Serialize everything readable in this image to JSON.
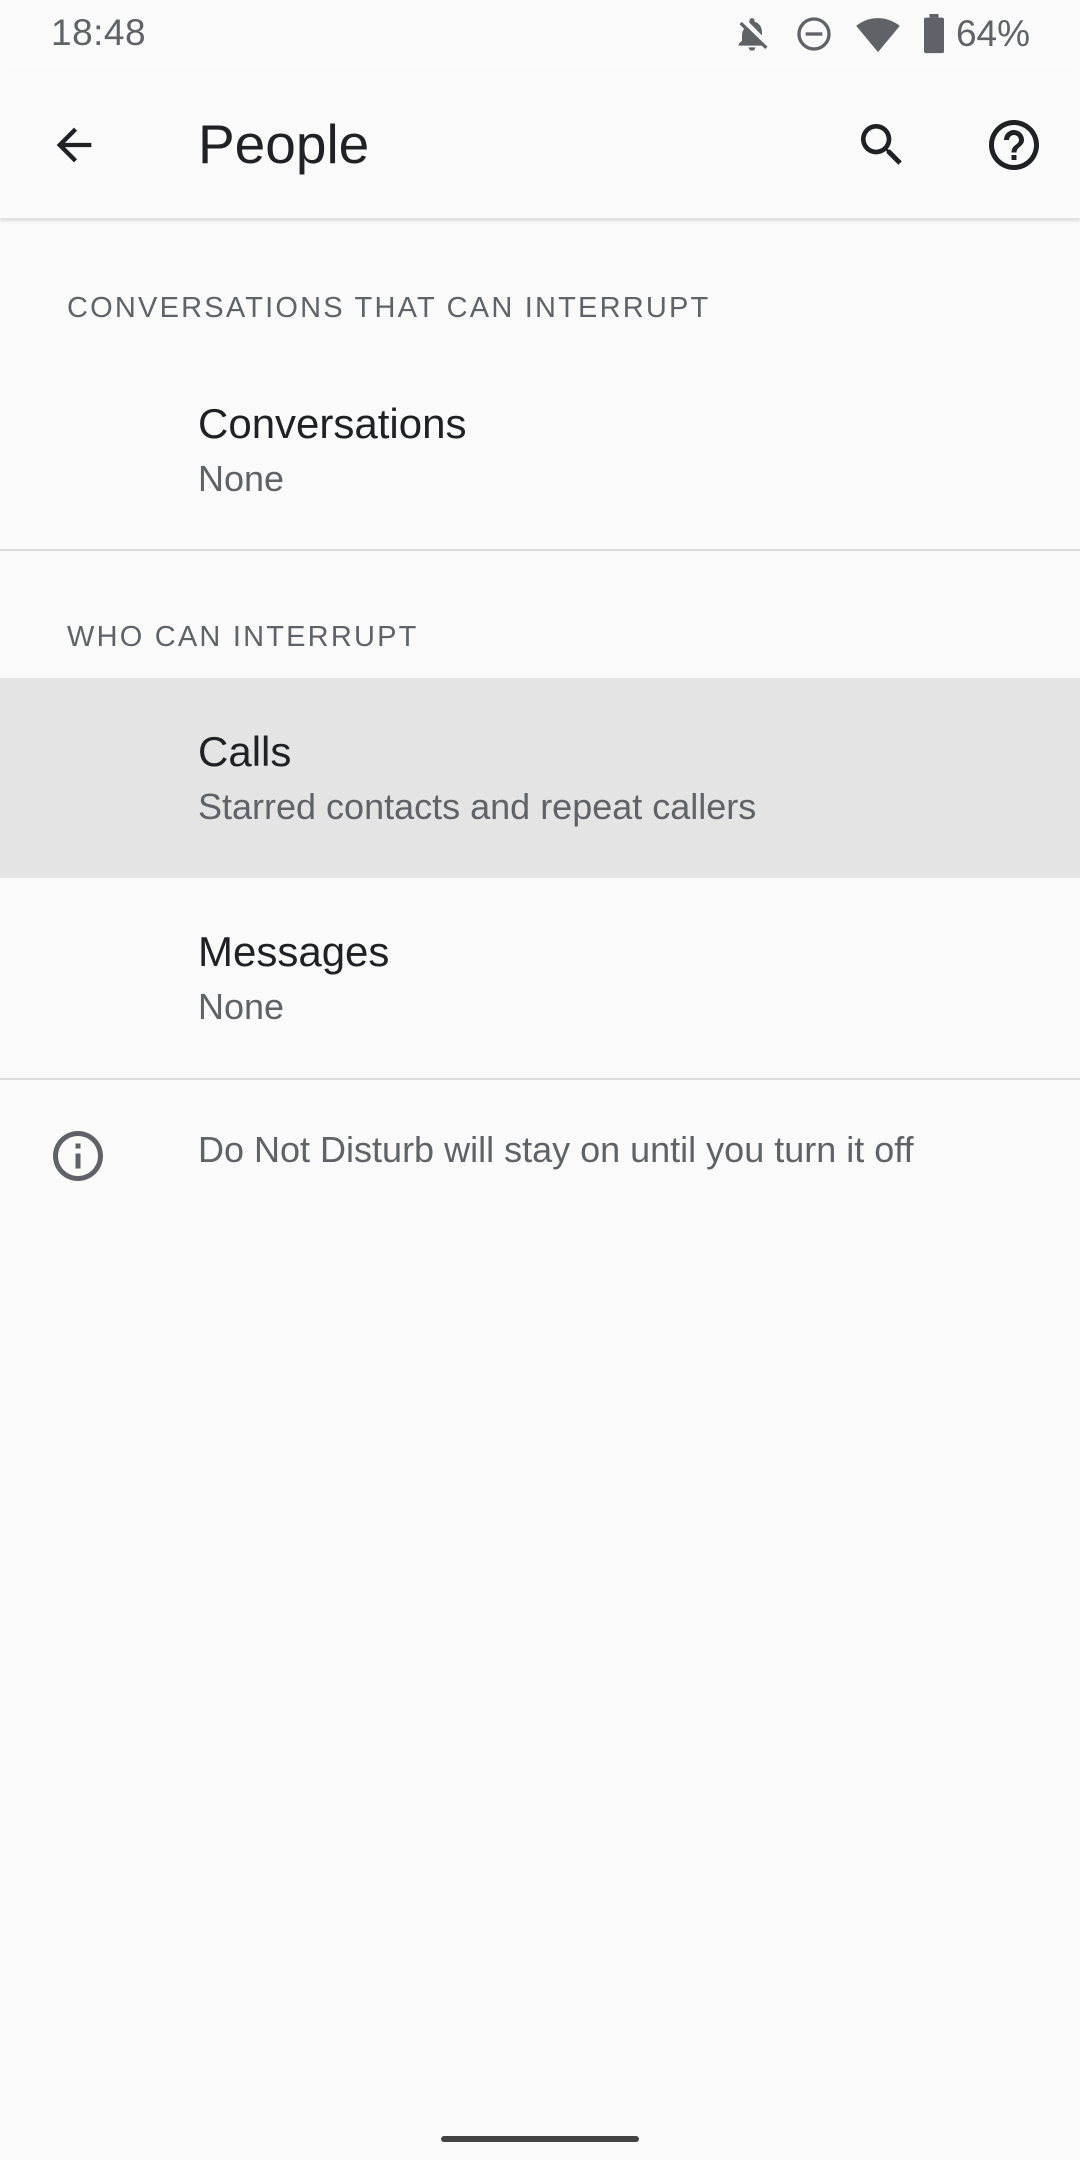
{
  "status_bar": {
    "time": "18:48",
    "battery_percent": "64%",
    "icons": [
      "bell-off-icon",
      "do-not-disturb-icon",
      "wifi-icon",
      "battery-icon"
    ]
  },
  "app_bar": {
    "title": "People",
    "back_icon": "arrow-back-icon",
    "search_icon": "search-icon",
    "help_icon": "help-icon"
  },
  "sections": {
    "conversations": {
      "header": "CONVERSATIONS THAT CAN INTERRUPT",
      "item": {
        "title": "Conversations",
        "summary": "None"
      }
    },
    "who_can_interrupt": {
      "header": "WHO CAN INTERRUPT",
      "calls": {
        "title": "Calls",
        "summary": "Starred contacts and repeat callers"
      },
      "messages": {
        "title": "Messages",
        "summary": "None"
      }
    }
  },
  "footer": {
    "icon": "info-icon",
    "text": "Do Not Disturb will stay on until you turn it off"
  },
  "colors": {
    "background": "#fafafa",
    "highlight": "#e4e4e4",
    "primary_text": "#202124",
    "secondary_text": "#5f6368"
  }
}
